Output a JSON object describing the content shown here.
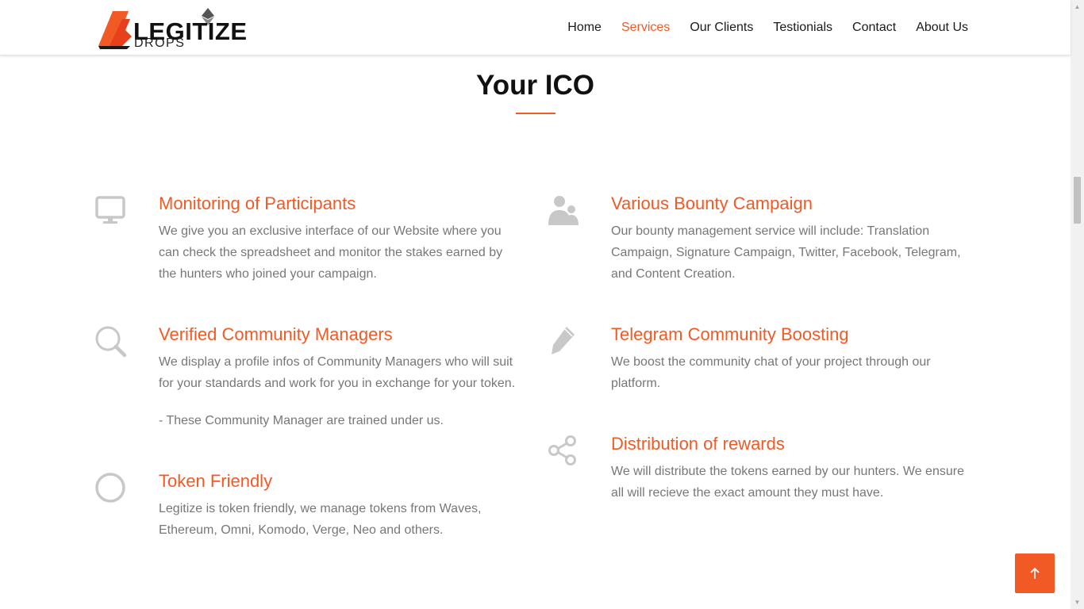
{
  "header": {
    "logo_text": "LEGITIZE",
    "logo_sub": "DROPS",
    "nav": [
      {
        "label": "Home",
        "active": false
      },
      {
        "label": "Services",
        "active": true
      },
      {
        "label": "Our Clients",
        "active": false
      },
      {
        "label": "Testionials",
        "active": false
      },
      {
        "label": "Contact",
        "active": false
      },
      {
        "label": "About Us",
        "active": false
      }
    ]
  },
  "section": {
    "title": "Your ICO",
    "accent_color": "#f15a24",
    "icon_color": "#c8c8c8"
  },
  "features": [
    {
      "icon": "monitor-icon",
      "title": "Monitoring of Participants",
      "text": "We give you an exclusive interface of our Website where you can check the spreadsheet and monitor the stakes earned by the hunters who joined your campaign."
    },
    {
      "icon": "users-icon",
      "title": "Various Bounty Campaign",
      "text": "Our bounty management service will include: Translation Campaign, Signature Campaign, Twitter, Facebook, Telegram, and Content Creation."
    },
    {
      "icon": "search-icon",
      "title": "Verified Community Managers",
      "text": "We display a profile infos of Community Managers who will suit for your standards and work for you in exchange for your token.",
      "note": "- These Community Manager are trained under us."
    },
    {
      "icon": "pencil-icon",
      "title": "Telegram Community Boosting",
      "text": "We boost the community chat of your project through our platform."
    },
    {
      "icon": "share-icon",
      "title": "Distribution of rewards",
      "text": "We will distribute the tokens earned by our hunters. We ensure all will recieve the exact amount they must have."
    },
    {
      "icon": "circle-icon",
      "title": "Token Friendly",
      "text": "Legitize is token friendly, we manage tokens from Waves, Ethereum, Omni, Komodo, Verge, Neo and others."
    }
  ],
  "back_to_top": {
    "icon": "arrow-up-icon"
  }
}
